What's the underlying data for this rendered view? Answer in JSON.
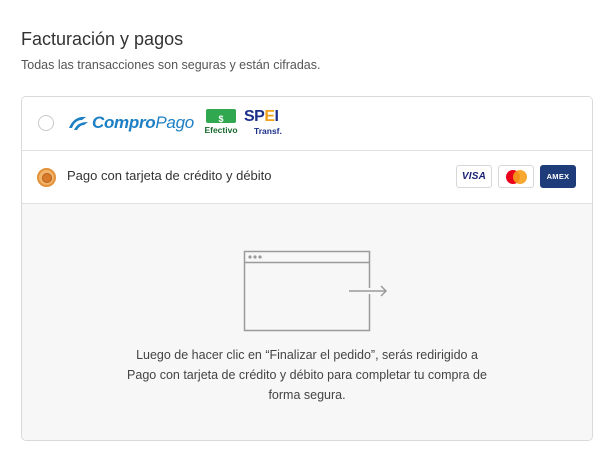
{
  "section": {
    "title": "Facturación y pagos",
    "subtitle": "Todas las transacciones son seguras y están cifradas."
  },
  "payment_options": {
    "compropago": {
      "logo_text_1": "Compro",
      "logo_text_2": "Pago",
      "efectivo_symbol": "$",
      "efectivo_label": "Efectivo",
      "spei_label": "SPEI",
      "spei_sub": "Transf.",
      "selected": false
    },
    "card": {
      "label": "Pago con tarjeta de crédito y débito",
      "selected": true,
      "brands": [
        "VISA",
        "Mastercard",
        "AMEX"
      ],
      "visa_text": "VISA",
      "amex_text": "AMEX"
    }
  },
  "redirect": {
    "line1": "Luego de hacer clic en “Finalizar el pedido”, serás redirigido a",
    "line2": "Pago con tarjeta de crédito y débito para completar tu compra de",
    "line3": "forma segura."
  },
  "colors": {
    "accent_radio": "#e4913a",
    "compropago_blue": "#1d7fc4",
    "spei_blue": "#1b2f8a",
    "efectivo_green": "#2fa84f",
    "amex_blue": "#1f3c7a"
  }
}
